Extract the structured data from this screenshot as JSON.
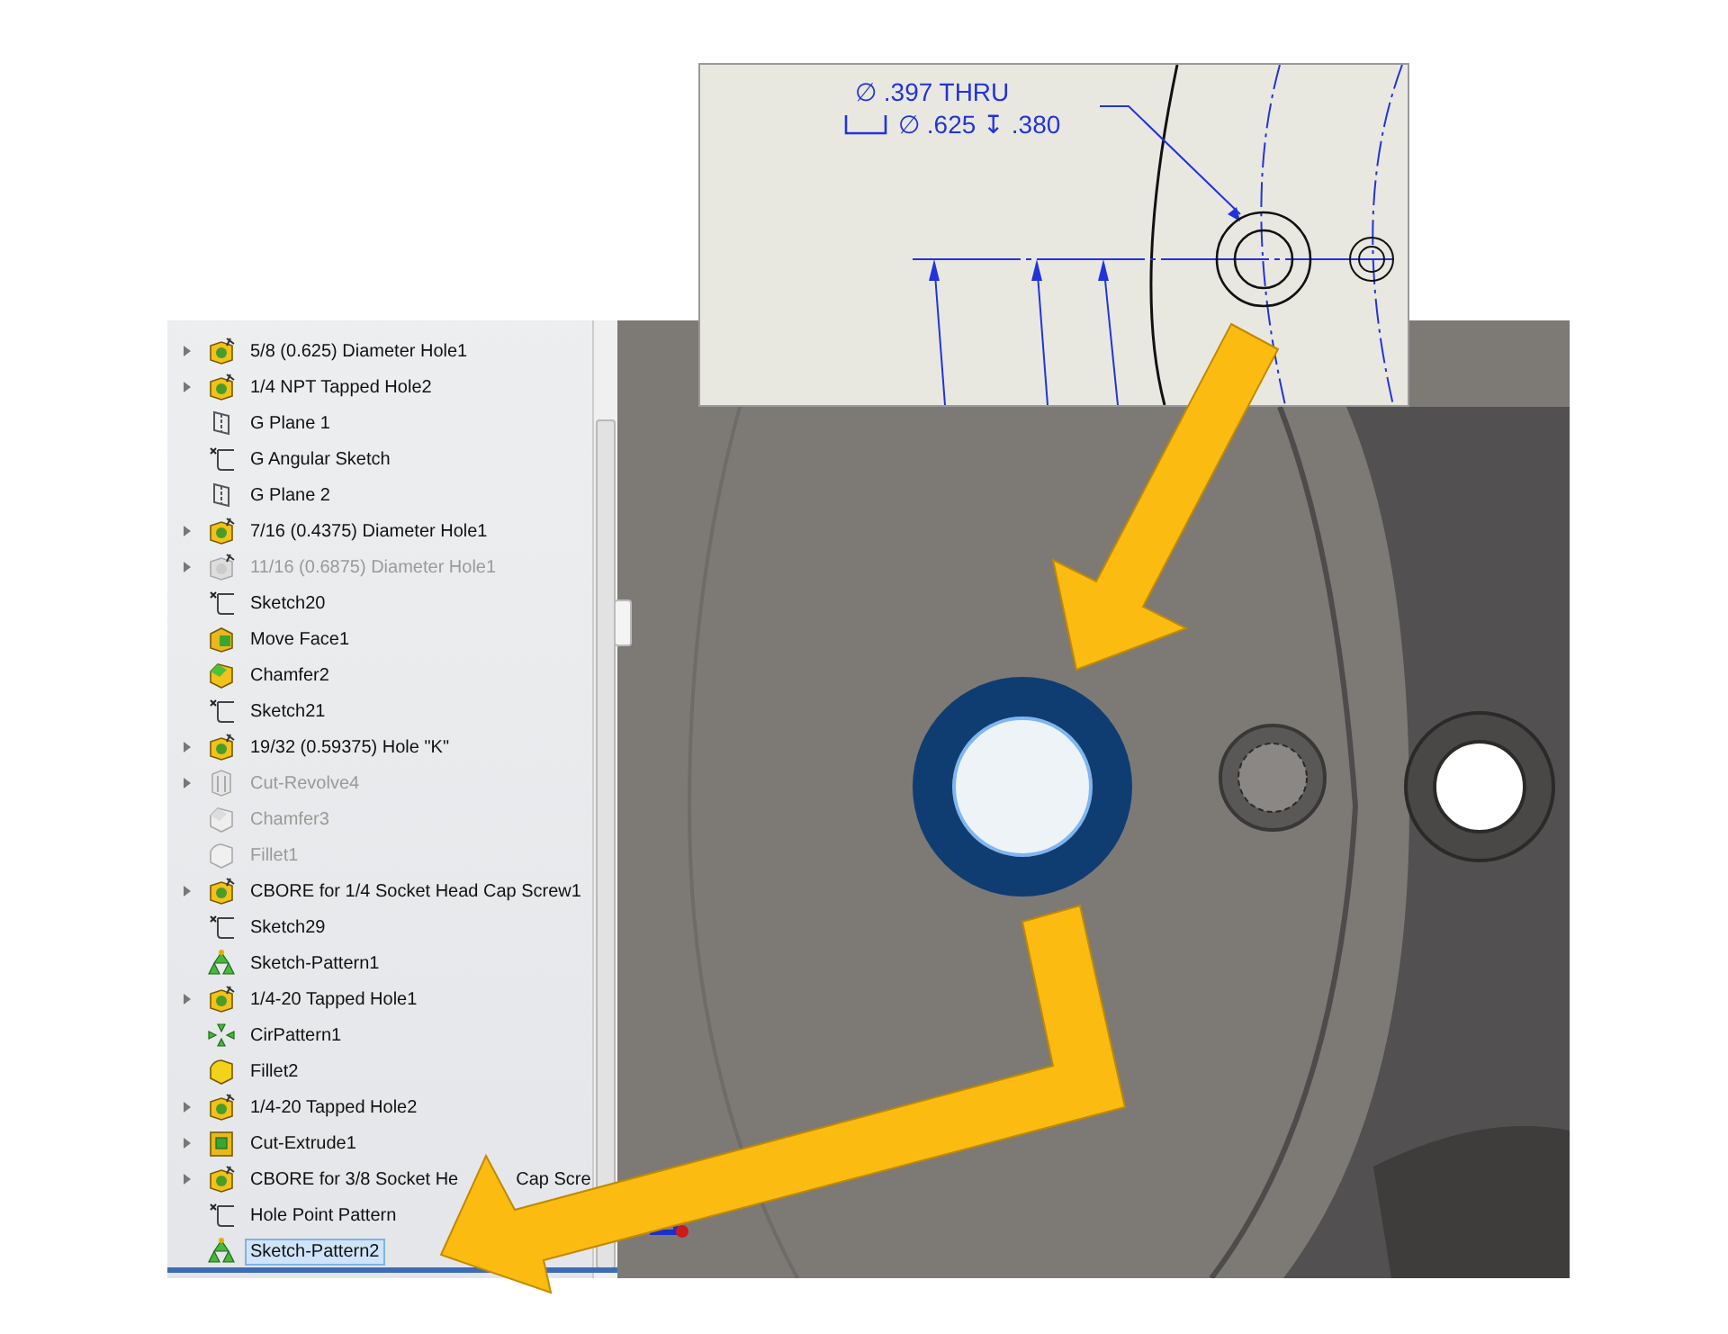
{
  "drawing_view": {
    "callout": {
      "thru_line": "∅ .397 THRU",
      "cbore_line": "∅ .625 ↧ .380"
    }
  },
  "feature_tree": {
    "items": [
      {
        "label": "5/8 (0.625) Diameter Hole1",
        "kind": "hole",
        "expandable": true,
        "suppressed": false,
        "selected": false
      },
      {
        "label": "1/4 NPT Tapped Hole2",
        "kind": "hole",
        "expandable": true,
        "suppressed": false,
        "selected": false
      },
      {
        "label": "G Plane 1",
        "kind": "plane",
        "expandable": false,
        "suppressed": false,
        "selected": false
      },
      {
        "label": "G Angular Sketch",
        "kind": "sketch",
        "expandable": false,
        "suppressed": false,
        "selected": false
      },
      {
        "label": "G Plane 2",
        "kind": "plane",
        "expandable": false,
        "suppressed": false,
        "selected": false
      },
      {
        "label": "7/16 (0.4375) Diameter Hole1",
        "kind": "hole",
        "expandable": true,
        "suppressed": false,
        "selected": false
      },
      {
        "label": "11/16 (0.6875) Diameter Hole1",
        "kind": "hole",
        "expandable": true,
        "suppressed": true,
        "selected": false
      },
      {
        "label": "Sketch20",
        "kind": "sketch",
        "expandable": false,
        "suppressed": false,
        "selected": false
      },
      {
        "label": "Move Face1",
        "kind": "moveface",
        "expandable": false,
        "suppressed": false,
        "selected": false
      },
      {
        "label": "Chamfer2",
        "kind": "chamfer",
        "expandable": false,
        "suppressed": false,
        "selected": false
      },
      {
        "label": "Sketch21",
        "kind": "sketch",
        "expandable": false,
        "suppressed": false,
        "selected": false
      },
      {
        "label": "19/32 (0.59375) Hole \"K\"",
        "kind": "hole",
        "expandable": true,
        "suppressed": false,
        "selected": false
      },
      {
        "label": "Cut-Revolve4",
        "kind": "revolve",
        "expandable": true,
        "suppressed": true,
        "selected": false
      },
      {
        "label": "Chamfer3",
        "kind": "chamfer",
        "expandable": false,
        "suppressed": true,
        "selected": false
      },
      {
        "label": "Fillet1",
        "kind": "fillet",
        "expandable": false,
        "suppressed": true,
        "selected": false
      },
      {
        "label": "CBORE for 1/4 Socket Head Cap Screw1",
        "kind": "hole",
        "expandable": true,
        "suppressed": false,
        "selected": false
      },
      {
        "label": "Sketch29",
        "kind": "sketch",
        "expandable": false,
        "suppressed": false,
        "selected": false
      },
      {
        "label": "Sketch-Pattern1",
        "kind": "pattern",
        "expandable": false,
        "suppressed": false,
        "selected": false
      },
      {
        "label": "1/4-20 Tapped Hole1",
        "kind": "hole",
        "expandable": true,
        "suppressed": false,
        "selected": false
      },
      {
        "label": "CirPattern1",
        "kind": "cirpattern",
        "expandable": false,
        "suppressed": false,
        "selected": false
      },
      {
        "label": "Fillet2",
        "kind": "fillet",
        "expandable": false,
        "suppressed": false,
        "selected": false
      },
      {
        "label": "1/4-20 Tapped Hole2",
        "kind": "hole",
        "expandable": true,
        "suppressed": false,
        "selected": false
      },
      {
        "label": "Cut-Extrude1",
        "kind": "extrude",
        "expandable": true,
        "suppressed": false,
        "selected": false
      },
      {
        "label": "CBORE for 3/8 Socket He",
        "label_tail": "Cap Scre",
        "kind": "hole",
        "expandable": true,
        "suppressed": false,
        "selected": false
      },
      {
        "label": "Hole Point Pattern",
        "kind": "sketch",
        "expandable": false,
        "suppressed": false,
        "selected": false
      },
      {
        "label": "Sketch-Pattern2",
        "kind": "pattern",
        "expandable": false,
        "suppressed": false,
        "selected": true
      }
    ]
  }
}
